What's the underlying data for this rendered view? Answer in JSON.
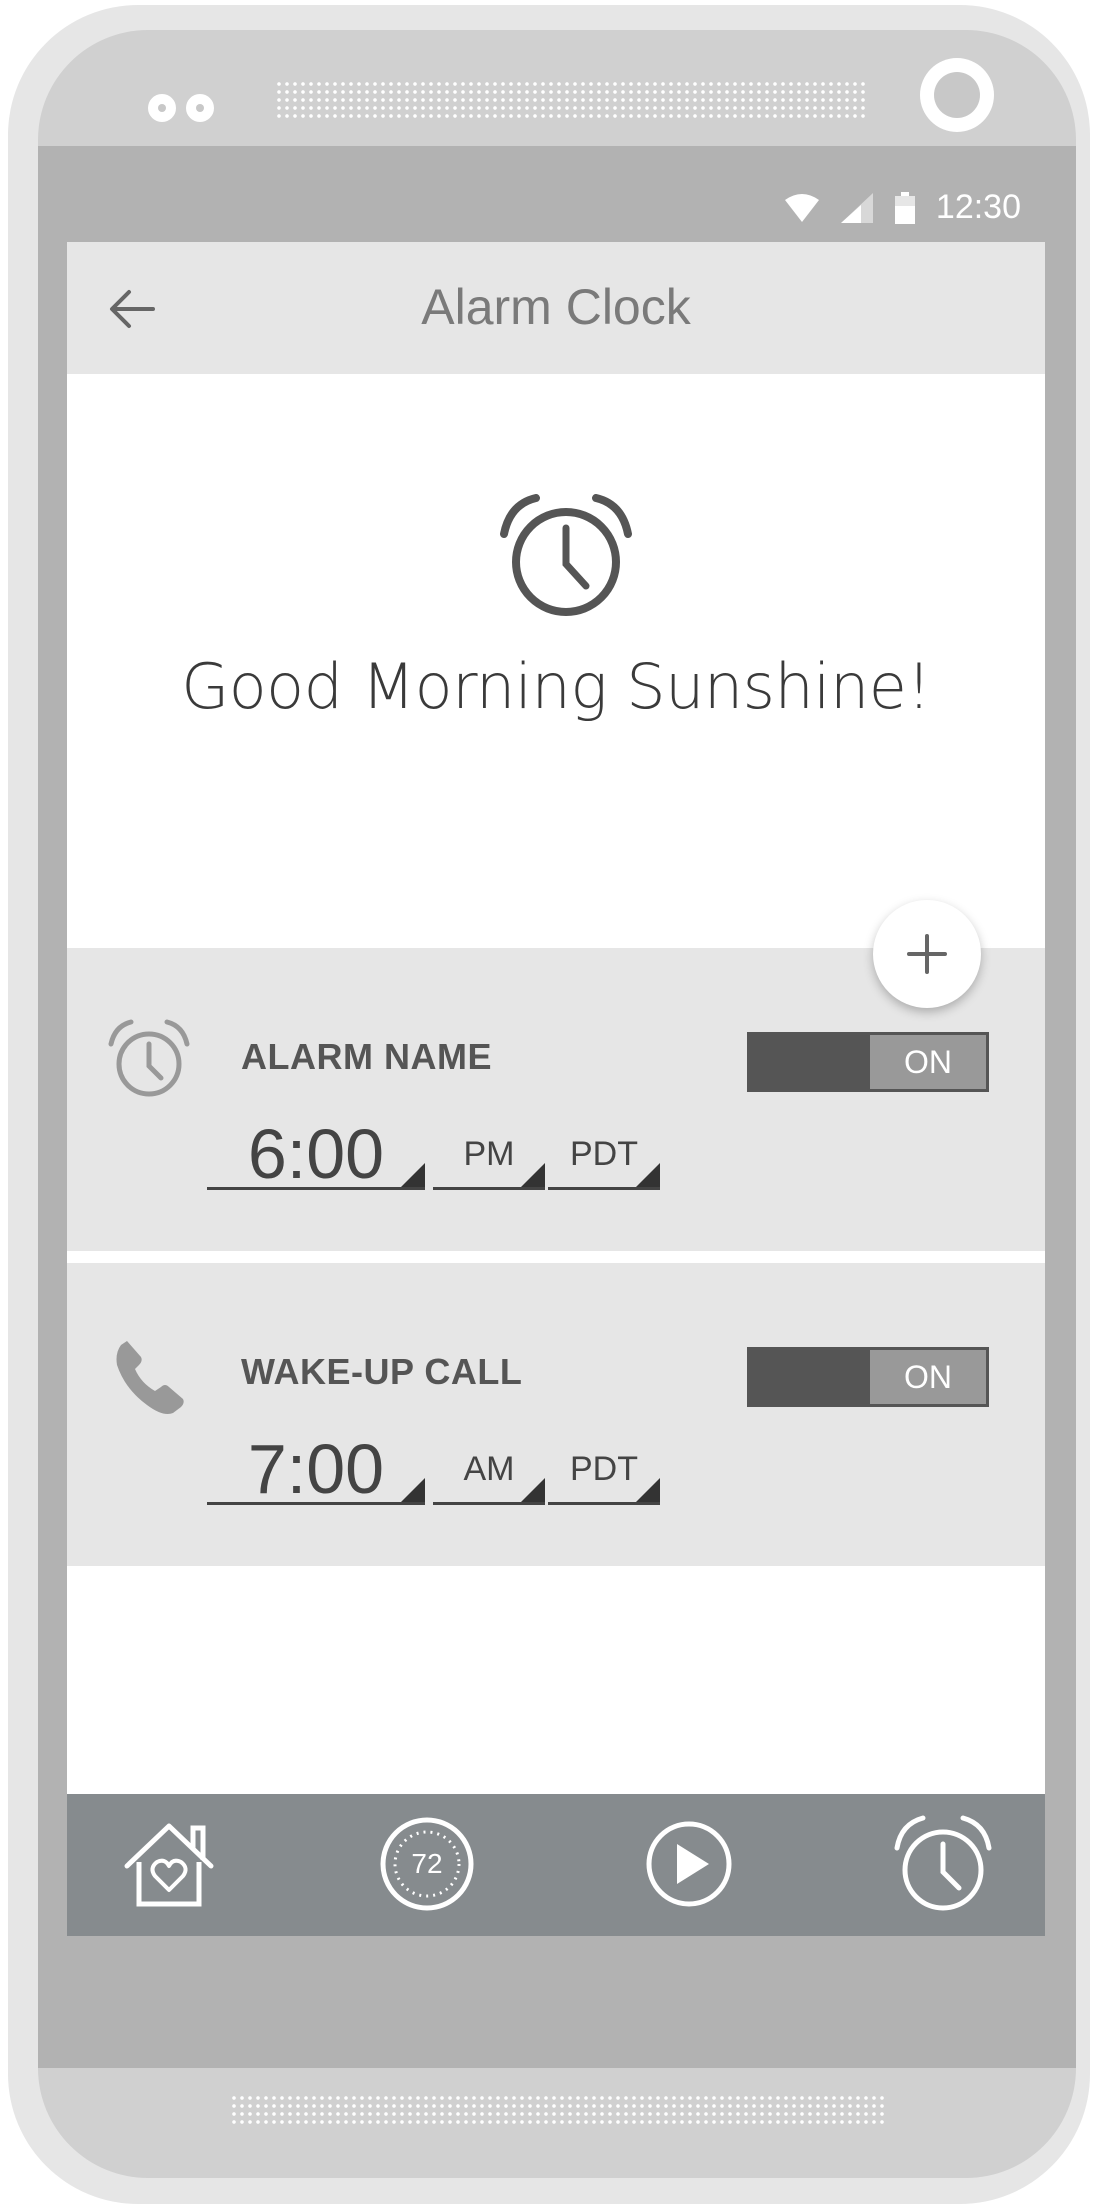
{
  "status_bar": {
    "time": "12:30",
    "icons": [
      "wifi-icon",
      "signal-icon",
      "battery-icon"
    ]
  },
  "app_bar": {
    "title": "Alarm Clock",
    "back_icon": "arrow-left-icon"
  },
  "hero": {
    "icon": "alarm-clock-icon",
    "greeting": "Good Morning Sunshine!"
  },
  "fab": {
    "icon": "plus-icon"
  },
  "alarms": [
    {
      "icon": "alarm-clock-icon",
      "name": "ALARM NAME",
      "toggle": "ON",
      "time": "6:00",
      "ampm": "PM",
      "timezone": "PDT"
    },
    {
      "icon": "phone-icon",
      "name": "WAKE-UP CALL",
      "toggle": "ON",
      "time": "7:00",
      "ampm": "AM",
      "timezone": "PDT"
    }
  ],
  "bottom_nav": {
    "items": [
      {
        "icon": "home-heart-icon"
      },
      {
        "icon": "thermostat-icon",
        "label": "72"
      },
      {
        "icon": "play-icon"
      },
      {
        "icon": "alarm-clock-icon"
      }
    ]
  },
  "colors": {
    "bezel": "#b2b2b2",
    "app_bar": "#e6e6e6",
    "card": "#e6e6e6",
    "nav": "#868b8e",
    "toggle_dark": "#555555"
  }
}
